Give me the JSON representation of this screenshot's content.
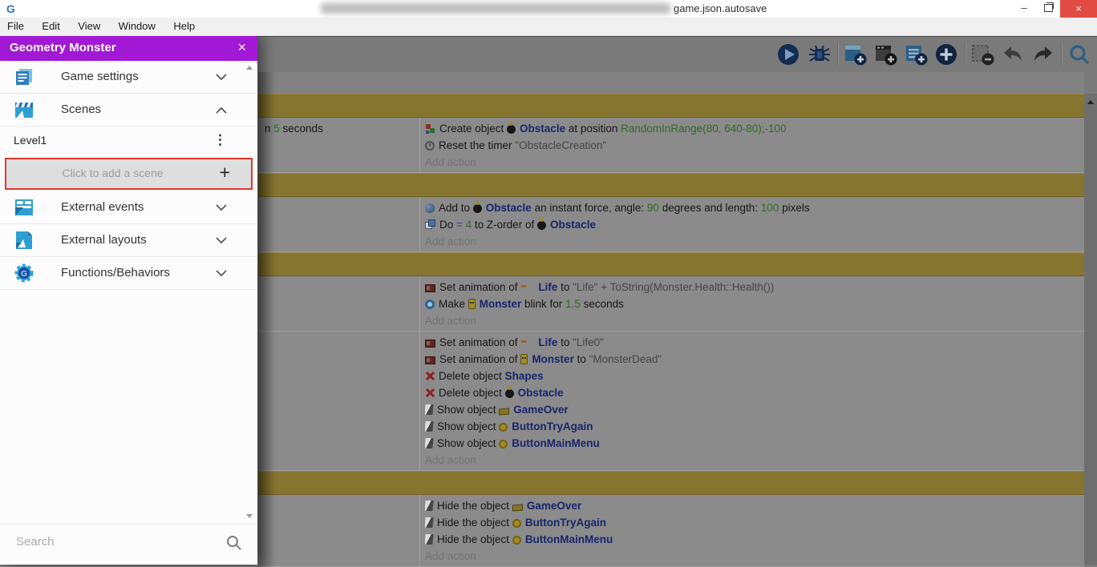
{
  "window": {
    "title": "game.json.autosave",
    "controls": {
      "minimize": "–",
      "restore": "restore",
      "close": "×"
    }
  },
  "menu_bar": {
    "items": [
      "File",
      "Edit",
      "View",
      "Window",
      "Help"
    ]
  },
  "toolbar": {
    "icons": [
      "play-icon",
      "debug-icon",
      "add-object-icon",
      "add-events-group-icon",
      "add-comment-icon",
      "add-event-icon",
      "remove-event-icon",
      "undo-icon",
      "redo-icon",
      "search-icon"
    ]
  },
  "project_manager": {
    "title": "Geometry Monster",
    "close_icon": "×",
    "accent_color": "#a119d4",
    "sections": [
      {
        "label": "Game settings",
        "icon": "game-settings-icon",
        "state": "collapsed"
      },
      {
        "label": "Scenes",
        "icon": "scenes-icon",
        "state": "expanded"
      },
      {
        "label": "External events",
        "icon": "external-events-icon",
        "state": "collapsed"
      },
      {
        "label": "External layouts",
        "icon": "external-layouts-icon",
        "state": "collapsed"
      },
      {
        "label": "Functions/Behaviors",
        "icon": "functions-icon",
        "state": "collapsed"
      }
    ],
    "scenes_list": {
      "items": [
        {
          "name": "Level1"
        }
      ],
      "add_label": "Click to add a scene",
      "highlight_color": "#d93a2f"
    },
    "search_placeholder": "Search"
  },
  "events_sheet": {
    "group_header_color": "#867531",
    "rows": [
      {
        "type": "partial"
      },
      {
        "type": "group"
      },
      {
        "type": "event",
        "conditions": [
          {
            "segments": [
              {
                "t": "txt",
                "v": "n "
              },
              {
                "t": "param",
                "v": "5"
              },
              {
                "t": "txt",
                "v": " seconds"
              }
            ]
          }
        ],
        "actions": [
          {
            "icon": "create-object-icon",
            "segments": [
              {
                "t": "txt",
                "v": "Create object "
              },
              {
                "t": "obj",
                "icon": "bomb-icon",
                "v": "Obstacle"
              },
              {
                "t": "txt",
                "v": " at position "
              },
              {
                "t": "param",
                "v": "RandomInRange(80, 640-80);-100"
              }
            ]
          },
          {
            "icon": "timer-icon",
            "segments": [
              {
                "t": "txt",
                "v": "Reset the timer "
              },
              {
                "t": "str",
                "v": "\"ObstacleCreation\""
              }
            ]
          },
          {
            "add": "Add action"
          }
        ]
      },
      {
        "type": "group"
      },
      {
        "type": "event",
        "conditions": [],
        "actions": [
          {
            "icon": "force-icon",
            "segments": [
              {
                "t": "txt",
                "v": "Add to "
              },
              {
                "t": "obj",
                "icon": "bomb-icon",
                "v": "Obstacle"
              },
              {
                "t": "txt",
                "v": " an instant force, angle: "
              },
              {
                "t": "param",
                "v": "90"
              },
              {
                "t": "txt",
                "v": " degrees and length: "
              },
              {
                "t": "param",
                "v": "100"
              },
              {
                "t": "txt",
                "v": " pixels"
              }
            ]
          },
          {
            "icon": "zorder-icon",
            "segments": [
              {
                "t": "txt",
                "v": "Do "
              },
              {
                "t": "op",
                "v": "= "
              },
              {
                "t": "param",
                "v": "4"
              },
              {
                "t": "txt",
                "v": " to Z-order of "
              },
              {
                "t": "obj",
                "icon": "bomb-icon",
                "v": "Obstacle"
              }
            ]
          },
          {
            "add": "Add action"
          }
        ]
      },
      {
        "type": "group"
      },
      {
        "type": "event",
        "conditions": [],
        "actions": [
          {
            "icon": "animation-icon",
            "segments": [
              {
                "t": "txt",
                "v": "Set animation of "
              },
              {
                "t": "obj",
                "icon": "life-icon",
                "v": "Life"
              },
              {
                "t": "txt",
                "v": " to "
              },
              {
                "t": "str",
                "v": "\"Life\" + ToString(Monster.Health::Health())"
              }
            ]
          },
          {
            "icon": "blink-icon",
            "segments": [
              {
                "t": "txt",
                "v": "Make "
              },
              {
                "t": "obj",
                "icon": "monster-icon",
                "v": "Monster"
              },
              {
                "t": "txt",
                "v": " blink for "
              },
              {
                "t": "param",
                "v": "1.5"
              },
              {
                "t": "txt",
                "v": " seconds"
              }
            ]
          },
          {
            "add": "Add action"
          }
        ]
      },
      {
        "type": "event",
        "conditions": [],
        "actions": [
          {
            "icon": "animation-icon",
            "segments": [
              {
                "t": "txt",
                "v": "Set animation of "
              },
              {
                "t": "obj",
                "icon": "life-icon",
                "v": "Life"
              },
              {
                "t": "txt",
                "v": " to "
              },
              {
                "t": "str",
                "v": "\"Life0\""
              }
            ]
          },
          {
            "icon": "animation-icon",
            "segments": [
              {
                "t": "txt",
                "v": "Set animation of "
              },
              {
                "t": "obj",
                "icon": "monster-icon",
                "v": "Monster"
              },
              {
                "t": "txt",
                "v": " to "
              },
              {
                "t": "str",
                "v": "\"MonsterDead\""
              }
            ]
          },
          {
            "icon": "delete-icon",
            "segments": [
              {
                "t": "txt",
                "v": "Delete object "
              },
              {
                "t": "obj",
                "v": "Shapes"
              }
            ]
          },
          {
            "icon": "delete-icon",
            "segments": [
              {
                "t": "txt",
                "v": "Delete object "
              },
              {
                "t": "obj",
                "icon": "bomb-icon",
                "v": "Obstacle"
              }
            ]
          },
          {
            "icon": "visibility-icon",
            "segments": [
              {
                "t": "txt",
                "v": "Show object "
              },
              {
                "t": "obj",
                "icon": "gameover-icon",
                "v": "GameOver"
              }
            ]
          },
          {
            "icon": "visibility-icon",
            "segments": [
              {
                "t": "txt",
                "v": "Show object "
              },
              {
                "t": "obj",
                "icon": "coin-icon",
                "v": "ButtonTryAgain"
              }
            ]
          },
          {
            "icon": "visibility-icon",
            "segments": [
              {
                "t": "txt",
                "v": "Show object "
              },
              {
                "t": "obj",
                "icon": "coin-icon",
                "v": "ButtonMainMenu"
              }
            ]
          },
          {
            "add": "Add action"
          }
        ]
      },
      {
        "type": "group"
      },
      {
        "type": "event",
        "conditions": [],
        "actions": [
          {
            "icon": "visibility-icon",
            "segments": [
              {
                "t": "txt",
                "v": "Hide the object "
              },
              {
                "t": "obj",
                "icon": "gameover-icon",
                "v": "GameOver"
              }
            ]
          },
          {
            "icon": "visibility-icon",
            "segments": [
              {
                "t": "txt",
                "v": "Hide the object "
              },
              {
                "t": "obj",
                "icon": "coin-icon",
                "v": "ButtonTryAgain"
              }
            ]
          },
          {
            "icon": "visibility-icon",
            "segments": [
              {
                "t": "txt",
                "v": "Hide the object "
              },
              {
                "t": "obj",
                "icon": "coin-icon",
                "v": "ButtonMainMenu"
              }
            ]
          },
          {
            "add": "Add action"
          }
        ]
      }
    ]
  }
}
